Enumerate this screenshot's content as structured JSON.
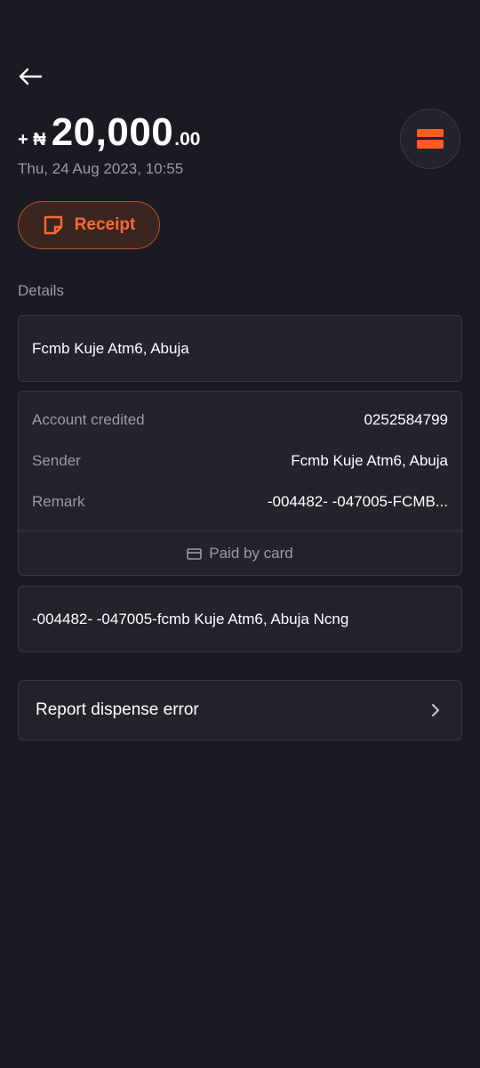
{
  "header": {
    "back_icon": "arrow-left-icon"
  },
  "transaction": {
    "sign": "+ ₦",
    "amount_main": "20,000",
    "amount_decimal": ".00",
    "datetime": "Thu, 24 Aug 2023, 10:55",
    "type_icon": "card-icon"
  },
  "receipt": {
    "label": "Receipt",
    "icon": "receipt-note-icon"
  },
  "details": {
    "section_label": "Details",
    "merchant": "Fcmb Kuje Atm6, Abuja",
    "rows": [
      {
        "key": "Account credited",
        "value": "0252584799"
      },
      {
        "key": "Sender",
        "value": "Fcmb Kuje Atm6, Abuja"
      },
      {
        "key": "Remark",
        "value": "-004482- -047005-FCMB..."
      }
    ],
    "paid_by": "Paid by card",
    "paid_by_icon": "card-outline-icon",
    "narration": "-004482- -047005-fcmb Kuje Atm6, Abuja Ncng"
  },
  "report": {
    "label": "Report dispense error",
    "icon": "chevron-right-icon"
  },
  "colors": {
    "background": "#1a1a22",
    "card": "#23232c",
    "accent": "#ff6a32",
    "muted_text": "#9b9ba6"
  }
}
